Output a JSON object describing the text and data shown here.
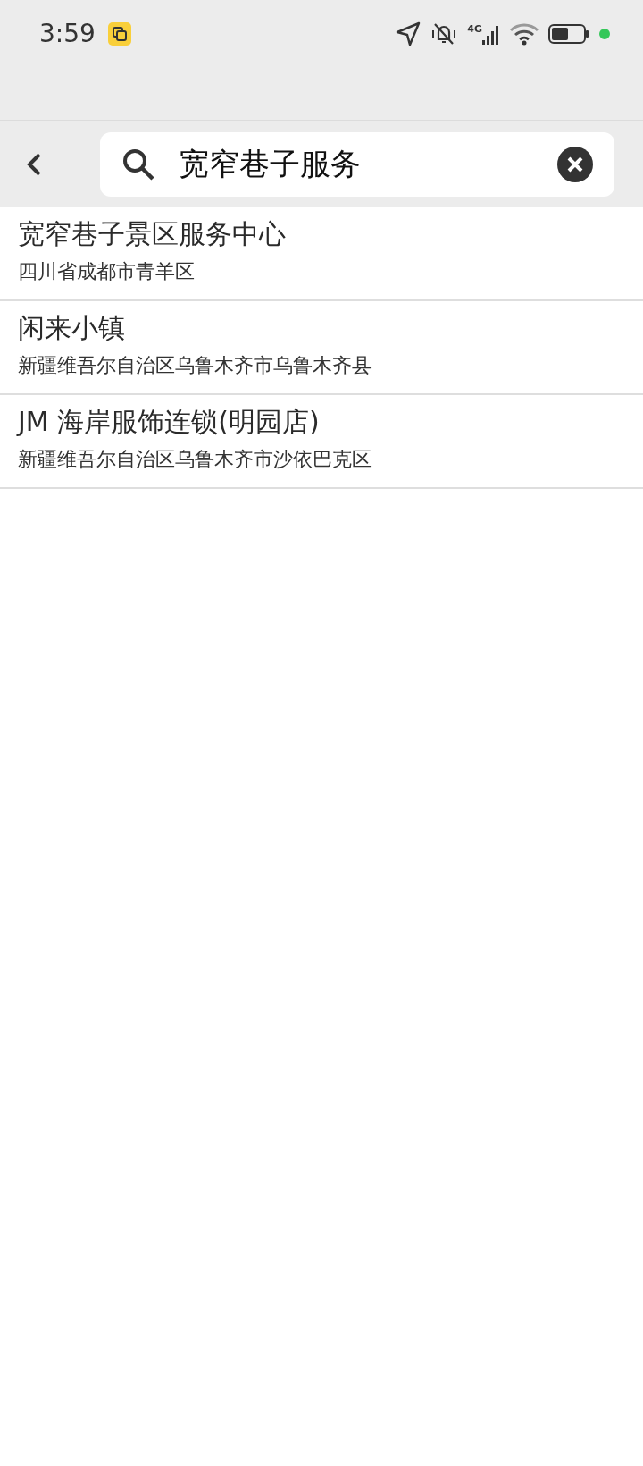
{
  "status_bar": {
    "time": "3:59",
    "network": "4G"
  },
  "search": {
    "value": "宽窄巷子服务"
  },
  "results": [
    {
      "name": "宽窄巷子景区服务中心",
      "address": "四川省成都市青羊区"
    },
    {
      "name": "闲来小镇",
      "address": "新疆维吾尔自治区乌鲁木齐市乌鲁木齐县"
    },
    {
      "name": "JM 海岸服饰连锁(明园店)",
      "address": "新疆维吾尔自治区乌鲁木齐市沙依巴克区"
    }
  ]
}
